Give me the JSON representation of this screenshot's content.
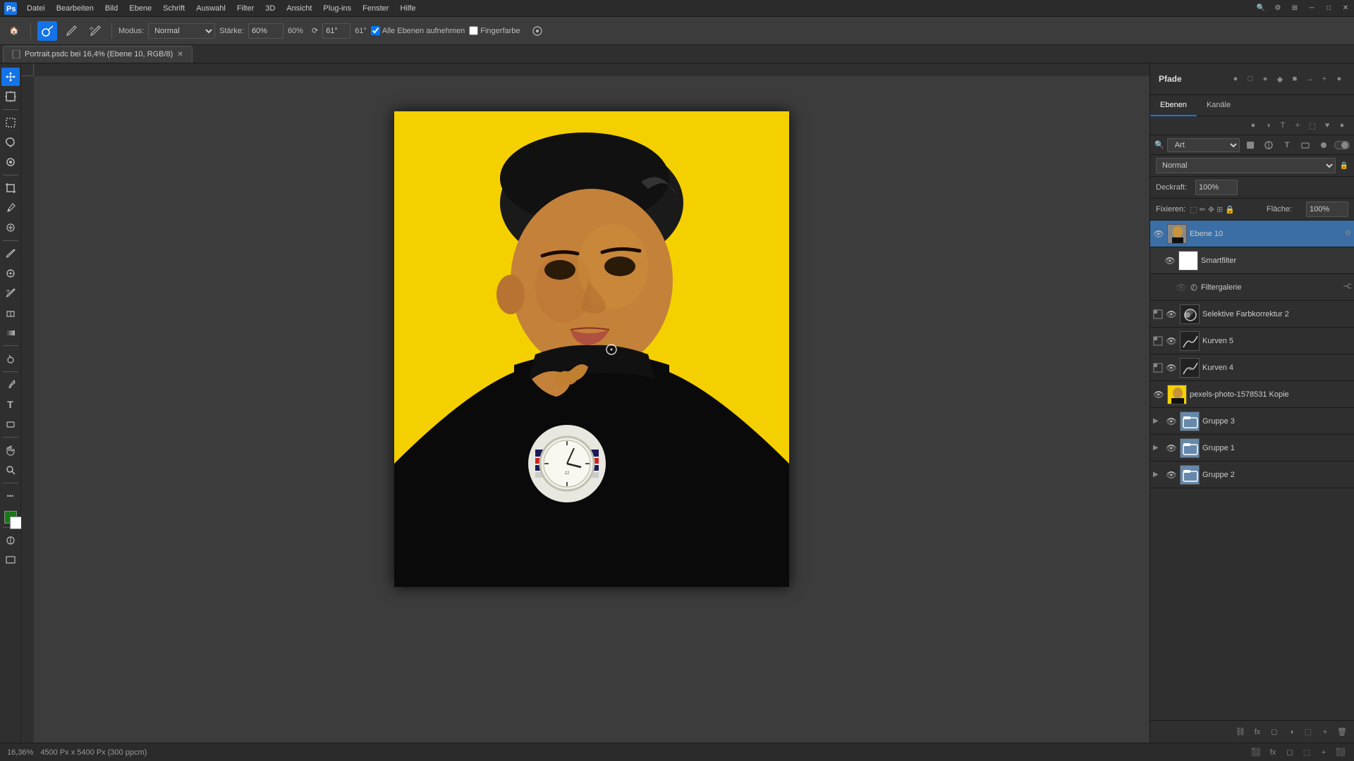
{
  "menubar": {
    "items": [
      "Datei",
      "Bearbeiten",
      "Bild",
      "Ebene",
      "Schrift",
      "Auswahl",
      "Filter",
      "3D",
      "Ansicht",
      "Plug-ins",
      "Fenster",
      "Hilfe"
    ]
  },
  "toolbar": {
    "mode_label": "Modus:",
    "mode_value": "Normal",
    "strength_label": "Stärke:",
    "strength_value": "60%",
    "angle_symbol": "⟳",
    "angle_value": "61°",
    "checkbox1_label": "Alle Ebenen aufnehmen",
    "checkbox2_label": "Fingerfarbe",
    "checkbox1_checked": true,
    "checkbox2_checked": false
  },
  "tabbar": {
    "tab_label": "Portrait.psdc bei 16,4% (Ebene 10, RGB/8)"
  },
  "canvas": {
    "zoom": "16,36%",
    "dimensions": "4500 Px x 5400 Px (300 ppcm)"
  },
  "paths_panel": {
    "title": "Pfade"
  },
  "layers_panel": {
    "tab1": "Ebenen",
    "tab2": "Kanäle",
    "search_placeholder": "Art",
    "blend_mode": "Normal",
    "opacity_label": "Deckraft:",
    "opacity_value": "100%",
    "lock_label": "Fixieren:",
    "fill_label": "Fläche:",
    "fill_value": "100%",
    "layers": [
      {
        "id": "ebene10",
        "name": "Ebene 10",
        "visible": true,
        "active": true,
        "type": "pixel",
        "thumb_color": "#888",
        "has_children": true,
        "indent": 0
      },
      {
        "id": "smartfilter",
        "name": "Smartfilter",
        "visible": true,
        "type": "filter",
        "thumb_color": "#fff",
        "indent": 1,
        "sub": true
      },
      {
        "id": "filtergalerie",
        "name": "Filtergalerie",
        "visible": false,
        "type": "filter",
        "thumb_color": "#555",
        "indent": 2,
        "sub": true
      },
      {
        "id": "selektive2",
        "name": "Selektive Farbkorrektur 2",
        "visible": true,
        "type": "adjustment",
        "thumb_color": "#222",
        "indent": 0
      },
      {
        "id": "kurven5",
        "name": "Kurven 5",
        "visible": true,
        "type": "adjustment",
        "thumb_color": "#222",
        "indent": 0
      },
      {
        "id": "kurven4",
        "name": "Kurven 4",
        "visible": true,
        "type": "adjustment",
        "thumb_color": "#222",
        "indent": 0
      },
      {
        "id": "photo-kopie",
        "name": "pexels-photo-1578531 Kopie",
        "visible": true,
        "type": "pixel",
        "thumb_color": "#c8a060",
        "indent": 0
      },
      {
        "id": "gruppe3",
        "name": "Gruppe 3",
        "visible": true,
        "type": "group",
        "thumb_color": "#6688aa",
        "indent": 0
      },
      {
        "id": "gruppe1",
        "name": "Gruppe 1",
        "visible": true,
        "type": "group",
        "thumb_color": "#6688aa",
        "indent": 0
      },
      {
        "id": "gruppe2",
        "name": "Gruppe 2",
        "visible": true,
        "type": "group",
        "thumb_color": "#6688aa",
        "indent": 0
      }
    ]
  },
  "statusbar": {
    "zoom": "16,36%",
    "dimensions": "4500 Px x 5400 Px (300 ppcm)"
  },
  "icons": {
    "eye": "👁",
    "lock": "🔒",
    "move": "✥",
    "lasso": "⊙",
    "magic_wand": "✦",
    "crop": "⌗",
    "brush": "✏",
    "clone": "⊕",
    "eraser": "◻",
    "gradient": "▣",
    "dodge": "◔",
    "pen": "✒",
    "text": "T",
    "shape": "▱",
    "hand": "✋",
    "zoom_tool": "🔍",
    "expand": "▶",
    "chain": "⛓",
    "filter_icon": "◈",
    "circle_dot": "◉"
  }
}
